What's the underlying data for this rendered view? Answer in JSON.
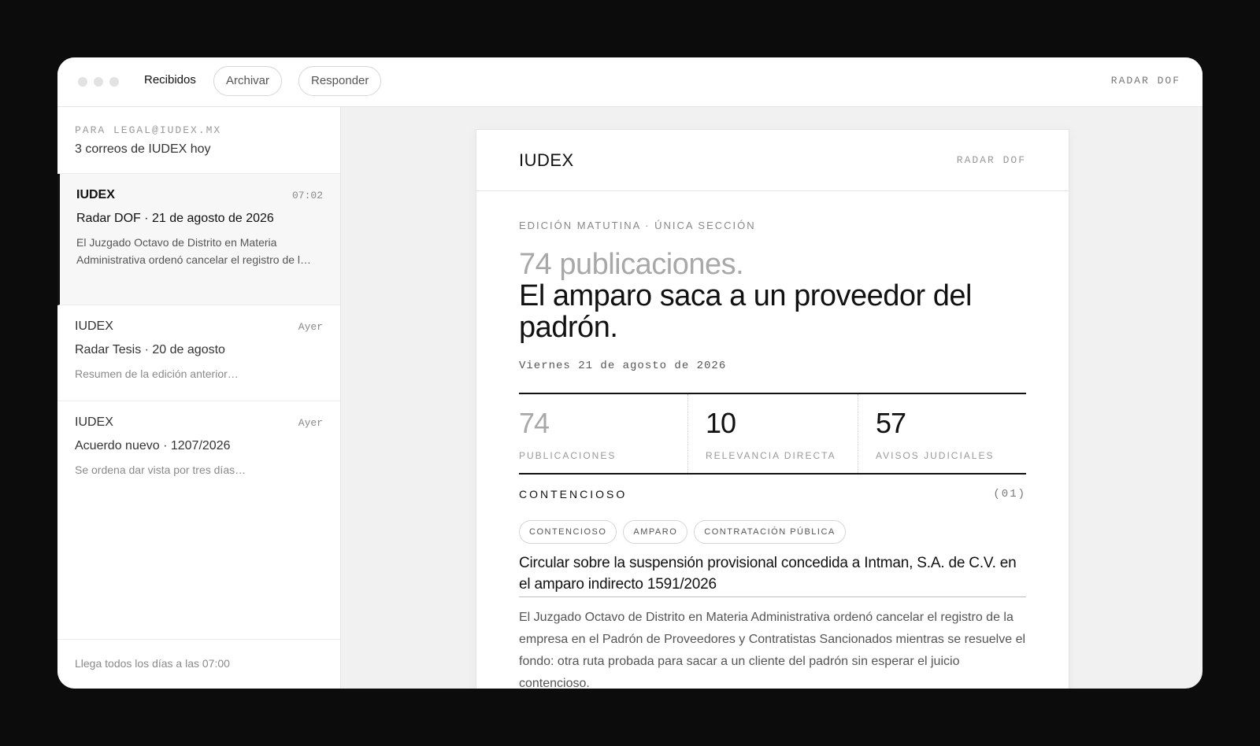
{
  "toolbar": {
    "inbox_label": "Recibidos",
    "archive_label": "Archivar",
    "reply_label": "Responder",
    "brand": "RADAR DOF"
  },
  "sidebar": {
    "to": "PARA LEGAL@IUDEX.MX",
    "count": "3 correos de IUDEX hoy",
    "messages": [
      {
        "from": "IUDEX",
        "time": "07:02",
        "subject": "Radar DOF · 21 de agosto de 2026",
        "preview": "El Juzgado Octavo de Distrito en Materia Administrativa ordenó cancelar el registro de l…"
      },
      {
        "from": "IUDEX",
        "time": "Ayer",
        "subject": "Radar Tesis · 20 de agosto",
        "preview": "Resumen de la edición anterior…"
      },
      {
        "from": "IUDEX",
        "time": "Ayer",
        "subject": "Acuerdo nuevo · 1207/2026",
        "preview": "Se ordena dar vista por tres días…"
      }
    ],
    "footer": "Llega todos los días a las 07:00"
  },
  "email": {
    "brand": "IUDEX",
    "tag": "RADAR DOF",
    "edition": "EDICIÓN MATUTINA · ÚNICA SECCIÓN",
    "headline_gray": "74 publicaciones.",
    "headline_main": "El amparo saca a un proveedor del padrón.",
    "date": "Viernes 21 de agosto de 2026",
    "stats": [
      {
        "value": "74",
        "label": "PUBLICACIONES"
      },
      {
        "value": "10",
        "label": "RELEVANCIA DIRECTA"
      },
      {
        "value": "57",
        "label": "AVISOS JUDICIALES"
      }
    ],
    "section": {
      "name": "CONTENCIOSO",
      "number": "(01)"
    },
    "chips": [
      "CONTENCIOSO",
      "AMPARO",
      "CONTRATACIÓN PÚBLICA"
    ],
    "article_title": "Circular sobre la suspensión provisional concedida a Intman, S.A. de C.V. en el amparo indirecto 1591/2026",
    "article_body": "El Juzgado Octavo de Distrito en Materia Administrativa ordenó cancelar el registro de la empresa en el Padrón de Proveedores y Contratistas Sancionados mientras se resuelve el fondo: otra ruta probada para sacar a un cliente del padrón sin esperar el juicio contencioso."
  }
}
